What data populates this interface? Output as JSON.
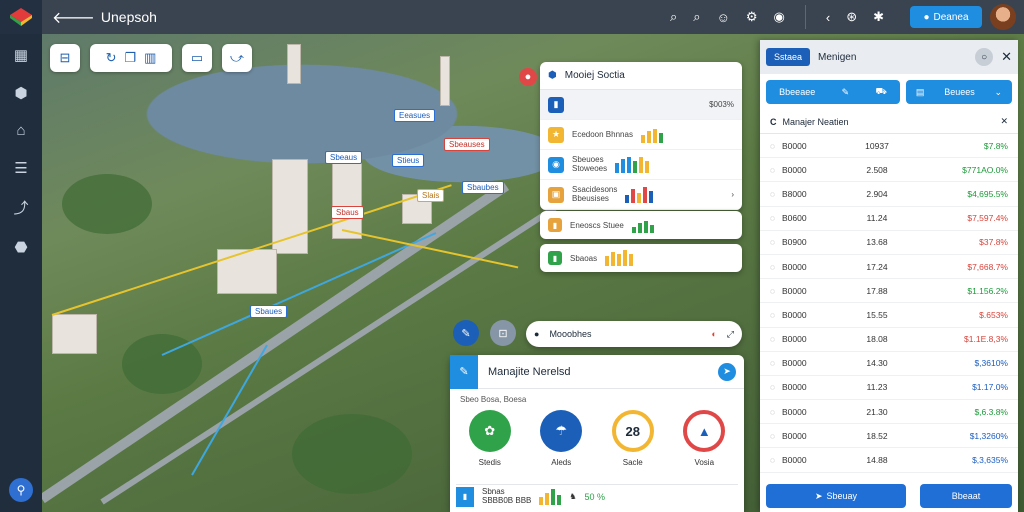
{
  "header": {
    "title": "Unepsoh",
    "button_label": "Deanea"
  },
  "map_tags": [
    "Eeasues",
    "Sbeaus",
    "Stieus",
    "Sbeauses",
    "Sbaubes",
    "Slais",
    "Sbaus",
    "Sbaues"
  ],
  "mid_card": {
    "title": "Mooiej Soctia",
    "rows": [
      {
        "label": "",
        "value": "$003%"
      },
      {
        "label": "Ecedoon Bhnnas",
        "value": ""
      },
      {
        "label": "Sbeuoes\nStoweoes",
        "value": ""
      },
      {
        "label": "Ssacidesons\nBbeusises",
        "value": ""
      }
    ]
  },
  "small_cards": [
    {
      "label": "Eneoscs Stuee"
    },
    {
      "label": "Sbaoas"
    }
  ],
  "search": {
    "placeholder": "Mooobhes"
  },
  "bottom_card": {
    "title": "Manajite Nerelsd",
    "subtitle": "Sbeo Bosa, Boesa",
    "circles": [
      {
        "label": "Stedis",
        "value": "",
        "color": "#2fa24a"
      },
      {
        "label": "Aleds",
        "value": "",
        "color": "#1b5fb8"
      },
      {
        "label": "Sacle",
        "value": "28",
        "color": "#f2b632"
      },
      {
        "label": "Vosia",
        "value": "",
        "color": "#e04848"
      }
    ],
    "foot_label": "Sbnas\nSBBB0B BBB",
    "foot_value": "50 %"
  },
  "right_panel": {
    "tab": "Sstaea",
    "title": "Menigen",
    "action1": "Bbeeaee",
    "action2": "Beuees",
    "section": "Manajer Neatien",
    "rows": [
      {
        "a": "B0000",
        "b": "10937",
        "c": "$7.8%",
        "color": "#1c9a3a"
      },
      {
        "a": "B0000",
        "b": "2.508",
        "c": "$771AO.0%",
        "color": "#1c9a3a"
      },
      {
        "a": "B8000",
        "b": "2.904",
        "c": "$4,695.5%",
        "color": "#1c9a3a"
      },
      {
        "a": "B0600",
        "b": "11.24",
        "c": "$7,597.4%",
        "color": "#d8443b"
      },
      {
        "a": "B0900",
        "b": "13.68",
        "c": "$37.8%",
        "color": "#d8443b"
      },
      {
        "a": "B0000",
        "b": "17.24",
        "c": "$7,668.7%",
        "color": "#d8443b"
      },
      {
        "a": "B0000",
        "b": "17.88",
        "c": "$1.156.2%",
        "color": "#1c9a3a"
      },
      {
        "a": "B0000",
        "b": "15.55",
        "c": "$.653%",
        "color": "#d8443b"
      },
      {
        "a": "B0000",
        "b": "18.08",
        "c": "$1.1E.8,3%",
        "color": "#d8443b"
      },
      {
        "a": "B0000",
        "b": "14.30",
        "c": "$,3610%",
        "color": "#1c5dbf"
      },
      {
        "a": "B0000",
        "b": "11.23",
        "c": "$1.17.0%",
        "color": "#1c5dbf"
      },
      {
        "a": "B0000",
        "b": "21.30",
        "c": "$,6.3.8%",
        "color": "#1c9a3a"
      },
      {
        "a": "B0000",
        "b": "18.52",
        "c": "$1,3260%",
        "color": "#1c5dbf"
      },
      {
        "a": "B0000",
        "b": "14.88",
        "c": "$,3,635%",
        "color": "#1c5dbf"
      }
    ],
    "foot1": "Sbeuay",
    "foot2": "Bbeaat"
  },
  "colors": {
    "accent": "#1f8de0",
    "sidebar": "#1f2d3d"
  }
}
